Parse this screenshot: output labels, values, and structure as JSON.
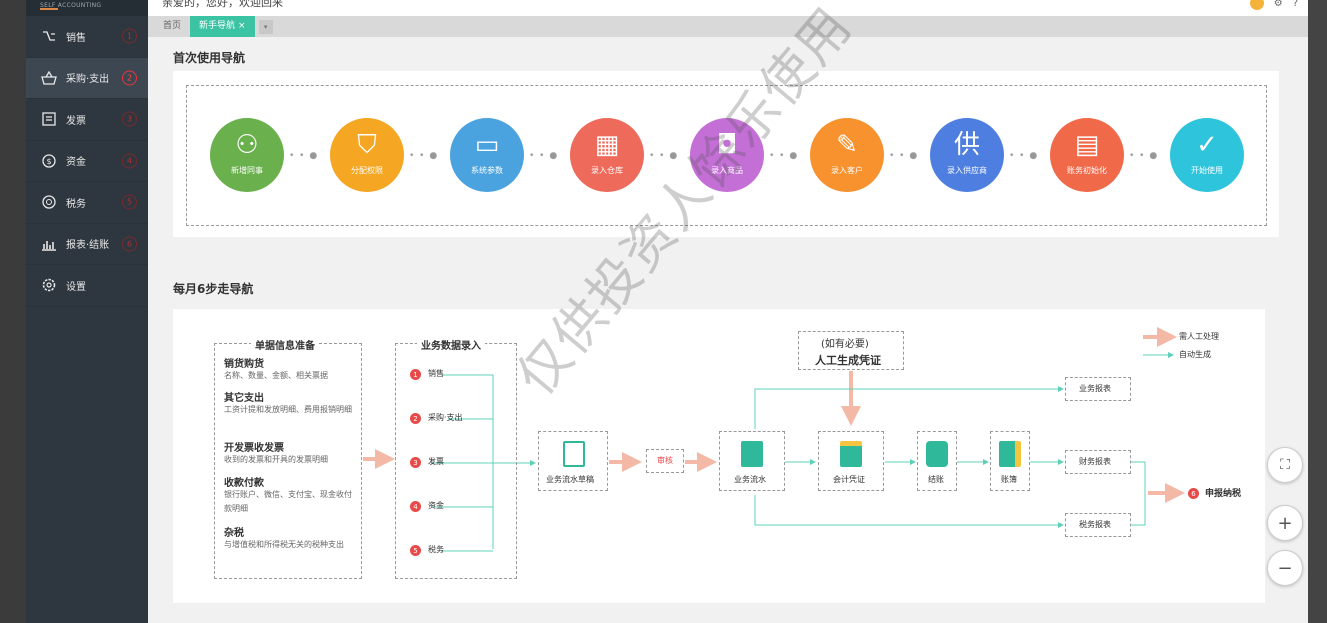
{
  "app": {
    "logo_text": "SELF ACCOUNTING",
    "greeting": "亲爱的，您好，欢迎回来"
  },
  "sidebar": {
    "items": [
      {
        "label": "销售",
        "badge": "1",
        "icon": "sales-icon"
      },
      {
        "label": "采购·支出",
        "badge": "2",
        "icon": "basket-icon"
      },
      {
        "label": "发票",
        "badge": "3",
        "icon": "invoice-icon"
      },
      {
        "label": "资金",
        "badge": "4",
        "icon": "dollar-icon"
      },
      {
        "label": "税务",
        "badge": "5",
        "icon": "tax-icon"
      },
      {
        "label": "报表·结账",
        "badge": "6",
        "icon": "bar-chart-icon"
      },
      {
        "label": "设置",
        "badge": "",
        "icon": "gear-icon"
      }
    ]
  },
  "tabs": {
    "home": "首页",
    "guide": "新手导航",
    "close": "×",
    "more": "▾"
  },
  "first_use": {
    "title": "首次使用导航",
    "steps": [
      {
        "label": "新增同事",
        "color": "#6ab04c",
        "icon": "add-user-icon",
        "glyph": "⚇"
      },
      {
        "label": "分配权限",
        "color": "#f5a623",
        "icon": "shield-key-icon",
        "glyph": "⛉"
      },
      {
        "label": "系统参数",
        "color": "#4aa3df",
        "icon": "monitor-icon",
        "glyph": "▭"
      },
      {
        "label": "录入仓库",
        "color": "#ee6a5a",
        "icon": "warehouse-icon",
        "glyph": "▦"
      },
      {
        "label": "录入商品",
        "color": "#c46fd6",
        "icon": "bag-icon",
        "glyph": "◘"
      },
      {
        "label": "录入客户",
        "color": "#f7922e",
        "icon": "edit-icon",
        "glyph": "✎"
      },
      {
        "label": "录入供应商",
        "color": "#4e7fe0",
        "icon": "supplier-icon",
        "glyph": "供"
      },
      {
        "label": "账务初始化",
        "color": "#f06a4a",
        "icon": "screen-chart-icon",
        "glyph": "▤"
      },
      {
        "label": "开始使用",
        "color": "#2ec4dc",
        "icon": "check-icon",
        "glyph": "✓"
      }
    ]
  },
  "monthly": {
    "title": "每月6步走导航",
    "prep": {
      "title": "单据信息准备",
      "items": [
        {
          "head": "销货购货",
          "desc": "名称、数量、金额、相关票据"
        },
        {
          "head": "其它支出",
          "desc": "工资计提和发放明细、费用报销明细"
        },
        {
          "head": "开发票收发票",
          "desc": "收到的发票和开具的发票明细"
        },
        {
          "head": "收款付款",
          "desc": "银行账户、微信、支付宝、现金收付款明细"
        },
        {
          "head": "杂税",
          "desc": "与增值税和所得税无关的税种支出"
        }
      ]
    },
    "entry": {
      "title": "业务数据录入",
      "items": [
        {
          "num": "1",
          "label": "销售"
        },
        {
          "num": "2",
          "label": "采购·支出"
        },
        {
          "num": "3",
          "label": "发票"
        },
        {
          "num": "4",
          "label": "资金"
        },
        {
          "num": "5",
          "label": "税务"
        }
      ]
    },
    "manual_note": {
      "line1": "(如有必要)",
      "line2": "人工生成凭证"
    },
    "nodes": {
      "draft": "业务流水草稿",
      "audit": "审核",
      "flow": "业务流水",
      "voucher": "会计凭证",
      "close": "结账",
      "ledger": "账簿",
      "biz_report": "业务报表",
      "fin_report": "财务报表",
      "tax_report": "税务报表",
      "declare_num": "6",
      "declare": "申报纳税"
    },
    "legend": {
      "manual": "需人工处理",
      "auto": "自动生成"
    },
    "colors": {
      "manual": "#f4b9a6",
      "auto": "#5fd0b8"
    }
  },
  "watermark": "仅供投资人馀乐使用",
  "float_buttons": {
    "fullscreen": "⛶",
    "zoom_in": "+",
    "zoom_out": "−"
  }
}
